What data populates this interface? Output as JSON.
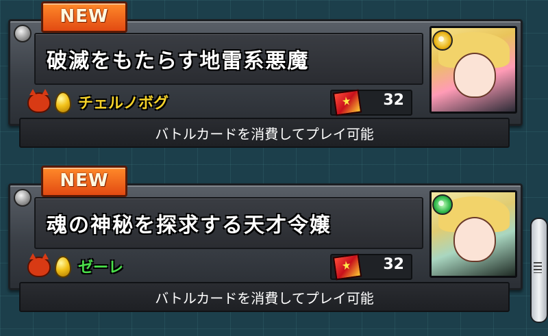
{
  "quests": [
    {
      "badge": "NEW",
      "title": "破滅をもたらす地雷系悪魔",
      "boss_name": "チェルノボグ",
      "boss_name_color": "#f6d32a",
      "battle_cards": "32",
      "footer": "バトルカードを消費してプレイ可能",
      "attribute": "light"
    },
    {
      "badge": "NEW",
      "title": "魂の神秘を探求する天才令嬢",
      "boss_name": "ゼーレ",
      "boss_name_color": "#4be04b",
      "battle_cards": "32",
      "footer": "バトルカードを消費してプレイ可能",
      "attribute": "wood"
    }
  ],
  "icons": {
    "difficulty": "demon-face-icon",
    "egg": "golden-egg-icon",
    "battle_card": "battle-card-icon",
    "scroll_grip": "scroll-grip-icon"
  },
  "colors": {
    "background": "#1c3f4b",
    "badge": "#e24a12",
    "frame": "#3a3f46"
  }
}
